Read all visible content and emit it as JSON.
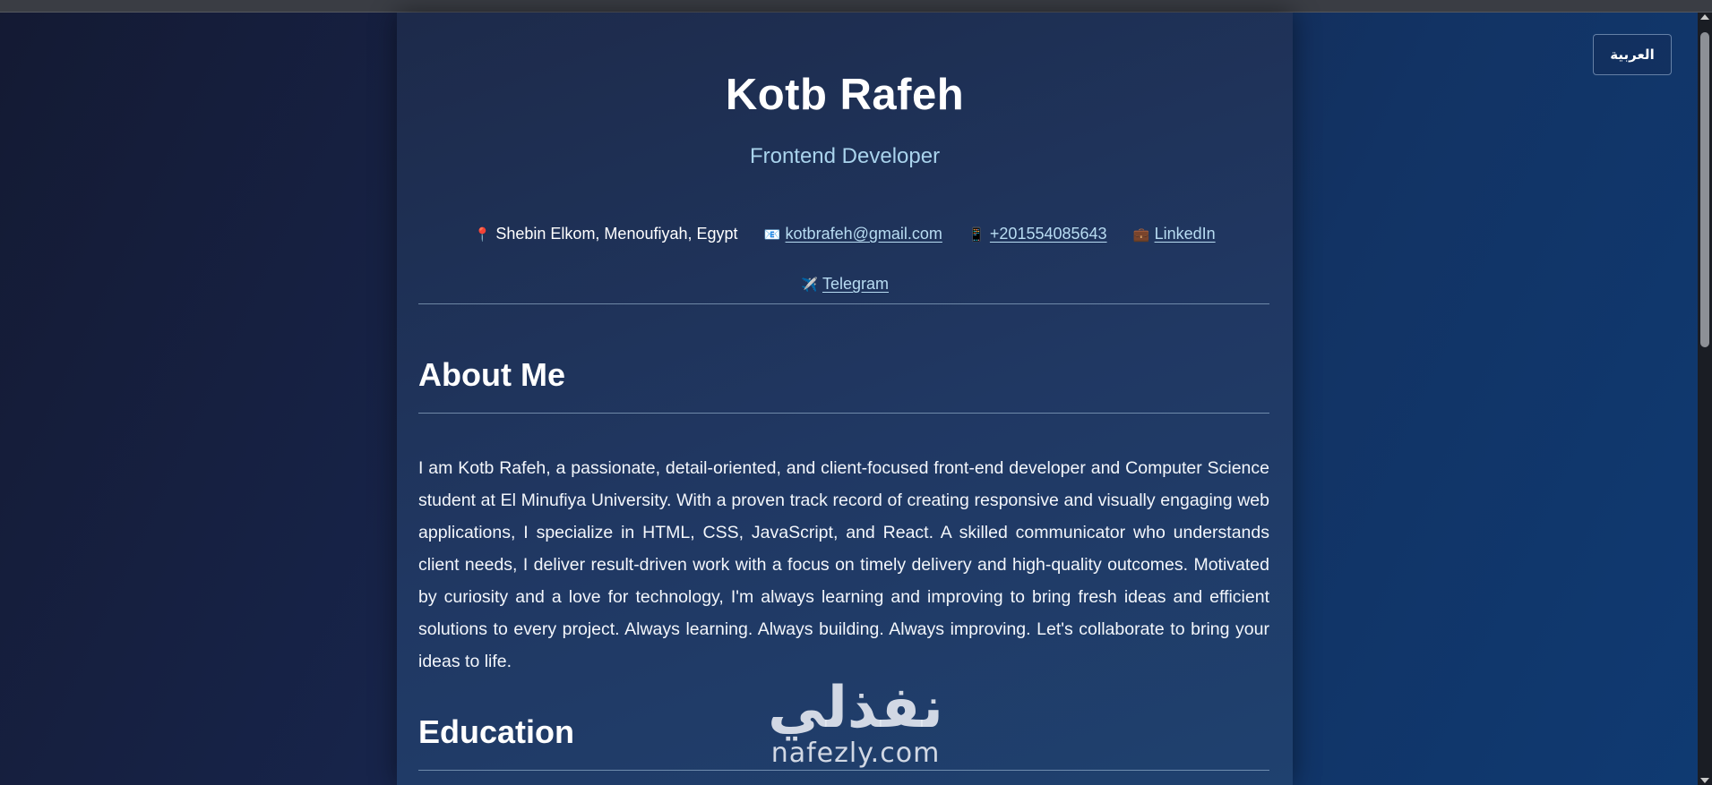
{
  "browser": {
    "language_button": "العربية"
  },
  "header": {
    "name": "Kotb Rafeh",
    "role": "Frontend Developer"
  },
  "contacts": [
    {
      "icon": "location-pin-icon",
      "glyph": "📍",
      "text": "Shebin Elkom, Menoufiyah, Egypt",
      "is_link": false
    },
    {
      "icon": "email-icon",
      "glyph": "📧",
      "text": "kotbrafeh@gmail.com",
      "is_link": true
    },
    {
      "icon": "phone-icon",
      "glyph": "📱",
      "text": "+201554085643",
      "is_link": true
    },
    {
      "icon": "briefcase-icon",
      "glyph": "💼",
      "text": "LinkedIn",
      "is_link": true
    },
    {
      "icon": "airplane-icon",
      "glyph": "✈️",
      "text": "Telegram",
      "is_link": true
    }
  ],
  "about": {
    "title": "About Me",
    "text": "I am Kotb Rafeh, a passionate, detail-oriented, and client-focused front-end developer and Computer Science student at El Minufiya University. With a proven track record of creating responsive and visually engaging web applications, I specialize in HTML, CSS, JavaScript, and React. A skilled communicator who understands client needs, I deliver result-driven work with a focus on timely delivery and high-quality outcomes. Motivated by curiosity and a love for technology, I'm always learning and improving to bring fresh ideas and efficient solutions to every project. Always learning. Always building. Always improving. Let's collaborate to bring your ideas to life."
  },
  "education": {
    "title": "Education"
  },
  "watermark": {
    "arabic": "نفذلي",
    "latin": "nafezly.com"
  },
  "colors": {
    "background_start": "#141a33",
    "background_end": "#0f3a72",
    "card": "#203863",
    "accent_text": "#a9d3ec",
    "link": "#b8dcf2"
  }
}
